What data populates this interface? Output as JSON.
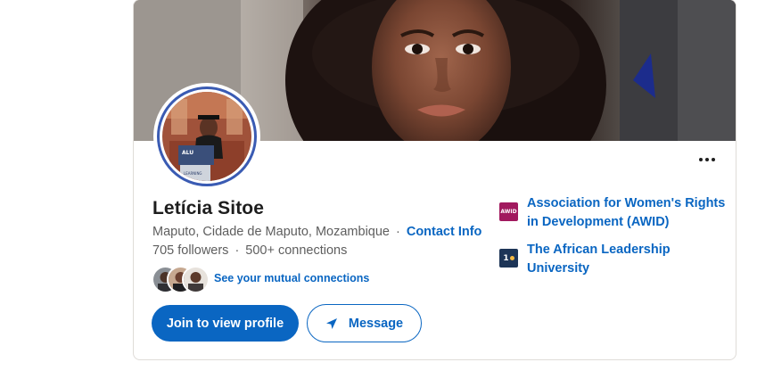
{
  "profile": {
    "name": "Letícia Sitoe",
    "location": "Maputo, Cidade de Maputo, Mozambique",
    "contact_info_label": "Contact Info",
    "followers": "705 followers",
    "connections": "500+ connections",
    "mutual_connections_label": "See your mutual connections",
    "avatar_banner_text": "ALU",
    "avatar_podium_text": "LEARNING"
  },
  "actions": {
    "join_label": "Join to view profile",
    "message_label": "Message",
    "more_icon": "more-horizontal-icon",
    "message_icon": "send-icon"
  },
  "organizations": [
    {
      "line1": "Association for Women's Rights",
      "line2": "in Development (AWID)",
      "logo_text": "AWID",
      "logo_color": "#a1195e"
    },
    {
      "line1": "The African Leadership",
      "line2": "University",
      "logo_text": "1",
      "logo_color": "#1d3557"
    }
  ],
  "colors": {
    "accent": "#0a66c2",
    "avatar_ring": "#3a5bb3",
    "text_primary": "#1d1d1d",
    "text_secondary": "#5e5e5e"
  }
}
